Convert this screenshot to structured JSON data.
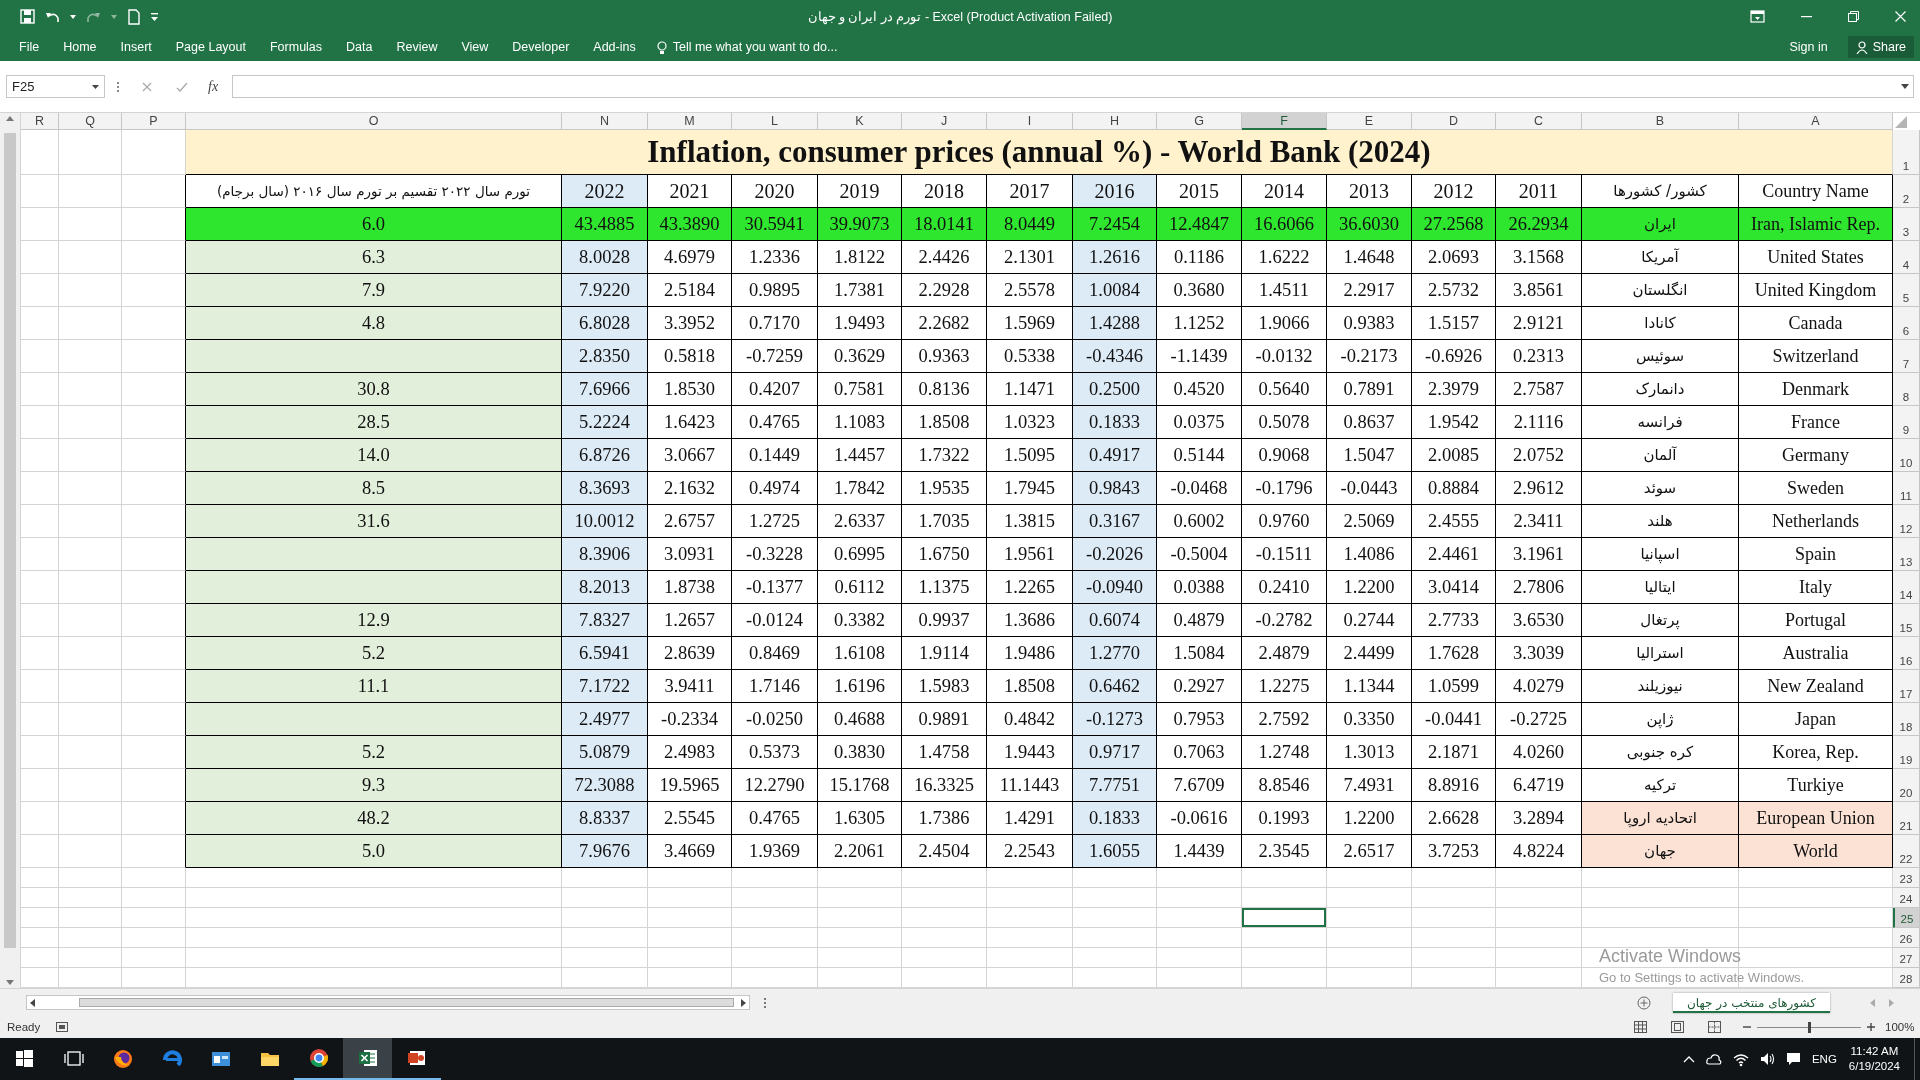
{
  "window": {
    "title": "تورم در ایران و جهان - Excel (Product Activation Failed)"
  },
  "ribbon": {
    "tabs": [
      {
        "label": "File",
        "selected": false
      },
      {
        "label": "Home",
        "selected": false
      },
      {
        "label": "Insert",
        "selected": false
      },
      {
        "label": "Page Layout",
        "selected": false
      },
      {
        "label": "Formulas",
        "selected": false
      },
      {
        "label": "Data",
        "selected": false
      },
      {
        "label": "Review",
        "selected": false
      },
      {
        "label": "View",
        "selected": false
      },
      {
        "label": "Developer",
        "selected": false
      },
      {
        "label": "Add-ins",
        "selected": false
      }
    ],
    "tell_me": "Tell me what you want to do...",
    "sign_in": "Sign in",
    "share": "Share"
  },
  "formula_bar": {
    "name_box": "F25",
    "function_label": "fx"
  },
  "sheet": {
    "columns": [
      {
        "label": "R",
        "selected": false
      },
      {
        "label": "Q",
        "selected": false
      },
      {
        "label": "P",
        "selected": false
      },
      {
        "label": "O",
        "selected": false
      },
      {
        "label": "N",
        "selected": false
      },
      {
        "label": "M",
        "selected": false
      },
      {
        "label": "L",
        "selected": false
      },
      {
        "label": "K",
        "selected": false
      },
      {
        "label": "J",
        "selected": false
      },
      {
        "label": "I",
        "selected": false
      },
      {
        "label": "H",
        "selected": false
      },
      {
        "label": "G",
        "selected": false
      },
      {
        "label": "F",
        "selected": true
      },
      {
        "label": "E",
        "selected": false
      },
      {
        "label": "D",
        "selected": false
      },
      {
        "label": "C",
        "selected": false
      },
      {
        "label": "B",
        "selected": false
      },
      {
        "label": "A",
        "selected": false
      }
    ],
    "rows": [
      {
        "label": "1",
        "selected": false
      },
      {
        "label": "2",
        "selected": false
      },
      {
        "label": "3",
        "selected": false
      },
      {
        "label": "4",
        "selected": false
      },
      {
        "label": "5",
        "selected": false
      },
      {
        "label": "6",
        "selected": false
      },
      {
        "label": "7",
        "selected": false
      },
      {
        "label": "8",
        "selected": false
      },
      {
        "label": "9",
        "selected": false
      },
      {
        "label": "10",
        "selected": false
      },
      {
        "label": "11",
        "selected": false
      },
      {
        "label": "12",
        "selected": false
      },
      {
        "label": "13",
        "selected": false
      },
      {
        "label": "14",
        "selected": false
      },
      {
        "label": "15",
        "selected": false
      },
      {
        "label": "16",
        "selected": false
      },
      {
        "label": "17",
        "selected": false
      },
      {
        "label": "18",
        "selected": false
      },
      {
        "label": "19",
        "selected": false
      },
      {
        "label": "20",
        "selected": false
      },
      {
        "label": "21",
        "selected": false
      },
      {
        "label": "22",
        "selected": false
      },
      {
        "label": "23",
        "selected": false
      },
      {
        "label": "24",
        "selected": false
      },
      {
        "label": "25",
        "selected": true
      },
      {
        "label": "26",
        "selected": false
      },
      {
        "label": "27",
        "selected": false
      },
      {
        "label": "28",
        "selected": false
      }
    ],
    "table": {
      "title": "Inflation, consumer prices (annual %) - World Bank (2024)",
      "header": {
        "ratio": "تورم سال ۲۰۲۲ تقسیم بر تورم سال ۲۰۱۶ (سال برجام)",
        "years": [
          {
            "label": "2022",
            "highlighted": true
          },
          {
            "label": "2021",
            "highlighted": false
          },
          {
            "label": "2020",
            "highlighted": false
          },
          {
            "label": "2019",
            "highlighted": false
          },
          {
            "label": "2018",
            "highlighted": false
          },
          {
            "label": "2017",
            "highlighted": false
          },
          {
            "label": "2016",
            "highlighted": true
          },
          {
            "label": "2015",
            "highlighted": false
          },
          {
            "label": "2014",
            "highlighted": false
          },
          {
            "label": "2013",
            "highlighted": false
          },
          {
            "label": "2012",
            "highlighted": false
          },
          {
            "label": "2011",
            "highlighted": false
          }
        ],
        "name_fa": "کشور/ کشورها",
        "name_en": "Country Name"
      },
      "records": [
        {
          "kind": "focus",
          "ratio": "6.0",
          "values": [
            "43.4885",
            "43.3890",
            "30.5941",
            "39.9073",
            "18.0141",
            "8.0449",
            "7.2454",
            "12.4847",
            "16.6066",
            "36.6030",
            "27.2568",
            "26.2934"
          ],
          "name_fa": "ایران",
          "name_en": "Iran, Islamic Rep."
        },
        {
          "kind": "plain",
          "ratio": "6.3",
          "values": [
            "8.0028",
            "4.6979",
            "1.2336",
            "1.8122",
            "2.4426",
            "2.1301",
            "1.2616",
            "0.1186",
            "1.6222",
            "1.4648",
            "2.0693",
            "3.1568"
          ],
          "name_fa": "آمریکا",
          "name_en": "United States"
        },
        {
          "kind": "plain",
          "ratio": "7.9",
          "values": [
            "7.9220",
            "2.5184",
            "0.9895",
            "1.7381",
            "2.2928",
            "2.5578",
            "1.0084",
            "0.3680",
            "1.4511",
            "2.2917",
            "2.5732",
            "3.8561"
          ],
          "name_fa": "انگلستان",
          "name_en": "United Kingdom"
        },
        {
          "kind": "plain",
          "ratio": "4.8",
          "values": [
            "6.8028",
            "3.3952",
            "0.7170",
            "1.9493",
            "2.2682",
            "1.5969",
            "1.4288",
            "1.1252",
            "1.9066",
            "0.9383",
            "1.5157",
            "2.9121"
          ],
          "name_fa": "کانادا",
          "name_en": "Canada"
        },
        {
          "kind": "plain",
          "values": [
            "2.8350",
            "0.5818",
            "-0.7259",
            "0.3629",
            "0.9363",
            "0.5338",
            "-0.4346",
            "-1.1439",
            "-0.0132",
            "-0.2173",
            "-0.6926",
            "0.2313"
          ],
          "name_fa": "سوئیس",
          "name_en": "Switzerland"
        },
        {
          "kind": "plain",
          "ratio": "30.8",
          "values": [
            "7.6966",
            "1.8530",
            "0.4207",
            "0.7581",
            "0.8136",
            "1.1471",
            "0.2500",
            "0.4520",
            "0.5640",
            "0.7891",
            "2.3979",
            "2.7587"
          ],
          "name_fa": "دانمارک",
          "name_en": "Denmark"
        },
        {
          "kind": "plain",
          "ratio": "28.5",
          "values": [
            "5.2224",
            "1.6423",
            "0.4765",
            "1.1083",
            "1.8508",
            "1.0323",
            "0.1833",
            "0.0375",
            "0.5078",
            "0.8637",
            "1.9542",
            "2.1116"
          ],
          "name_fa": "فرانسه",
          "name_en": "France"
        },
        {
          "kind": "plain",
          "ratio": "14.0",
          "values": [
            "6.8726",
            "3.0667",
            "0.1449",
            "1.4457",
            "1.7322",
            "1.5095",
            "0.4917",
            "0.5144",
            "0.9068",
            "1.5047",
            "2.0085",
            "2.0752"
          ],
          "name_fa": "آلمان",
          "name_en": "Germany"
        },
        {
          "kind": "plain",
          "ratio": "8.5",
          "values": [
            "8.3693",
            "2.1632",
            "0.4974",
            "1.7842",
            "1.9535",
            "1.7945",
            "0.9843",
            "-0.0468",
            "-0.1796",
            "-0.0443",
            "0.8884",
            "2.9612"
          ],
          "name_fa": "سوئد",
          "name_en": "Sweden"
        },
        {
          "kind": "plain",
          "ratio": "31.6",
          "values": [
            "10.0012",
            "2.6757",
            "1.2725",
            "2.6337",
            "1.7035",
            "1.3815",
            "0.3167",
            "0.6002",
            "0.9760",
            "2.5069",
            "2.4555",
            "2.3411"
          ],
          "name_fa": "هلند",
          "name_en": "Netherlands"
        },
        {
          "kind": "plain",
          "values": [
            "8.3906",
            "3.0931",
            "-0.3228",
            "0.6995",
            "1.6750",
            "1.9561",
            "-0.2026",
            "-0.5004",
            "-0.1511",
            "1.4086",
            "2.4461",
            "3.1961"
          ],
          "name_fa": "اسپانیا",
          "name_en": "Spain"
        },
        {
          "kind": "plain",
          "values": [
            "8.2013",
            "1.8738",
            "-0.1377",
            "0.6112",
            "1.1375",
            "1.2265",
            "-0.0940",
            "0.0388",
            "0.2410",
            "1.2200",
            "3.0414",
            "2.7806"
          ],
          "name_fa": "ایتالیا",
          "name_en": "Italy"
        },
        {
          "kind": "plain",
          "ratio": "12.9",
          "values": [
            "7.8327",
            "1.2657",
            "-0.0124",
            "0.3382",
            "0.9937",
            "1.3686",
            "0.6074",
            "0.4879",
            "-0.2782",
            "0.2744",
            "2.7733",
            "3.6530"
          ],
          "name_fa": "پرتغال",
          "name_en": "Portugal"
        },
        {
          "kind": "plain",
          "ratio": "5.2",
          "values": [
            "6.5941",
            "2.8639",
            "0.8469",
            "1.6108",
            "1.9114",
            "1.9486",
            "1.2770",
            "1.5084",
            "2.4879",
            "2.4499",
            "1.7628",
            "3.3039"
          ],
          "name_fa": "استرالیا",
          "name_en": "Australia"
        },
        {
          "kind": "plain",
          "ratio": "11.1",
          "values": [
            "7.1722",
            "3.9411",
            "1.7146",
            "1.6196",
            "1.5983",
            "1.8508",
            "0.6462",
            "0.2927",
            "1.2275",
            "1.1344",
            "1.0599",
            "4.0279"
          ],
          "name_fa": "نیوزیلند",
          "name_en": "New Zealand"
        },
        {
          "kind": "plain",
          "values": [
            "2.4977",
            "-0.2334",
            "-0.0250",
            "0.4688",
            "0.9891",
            "0.4842",
            "-0.1273",
            "0.7953",
            "2.7592",
            "0.3350",
            "-0.0441",
            "-0.2725"
          ],
          "name_fa": "ژاپن",
          "name_en": "Japan"
        },
        {
          "kind": "plain",
          "ratio": "5.2",
          "values": [
            "5.0879",
            "2.4983",
            "0.5373",
            "0.3830",
            "1.4758",
            "1.9443",
            "0.9717",
            "0.7063",
            "1.2748",
            "1.3013",
            "2.1871",
            "4.0260"
          ],
          "name_fa": "کره جنوبی",
          "name_en": "Korea, Rep."
        },
        {
          "kind": "plain",
          "ratio": "9.3",
          "values": [
            "72.3088",
            "19.5965",
            "12.2790",
            "15.1768",
            "16.3325",
            "11.1443",
            "7.7751",
            "7.6709",
            "8.8546",
            "7.4931",
            "8.8916",
            "6.4719"
          ],
          "name_fa": "ترکیه",
          "name_en": "Turkiye"
        },
        {
          "kind": "aggregate",
          "ratio": "48.2",
          "values": [
            "8.8337",
            "2.5545",
            "0.4765",
            "1.6305",
            "1.7386",
            "1.4291",
            "0.1833",
            "-0.0616",
            "0.1993",
            "1.2200",
            "2.6628",
            "3.2894"
          ],
          "name_fa": "اتحادیه اروپا",
          "name_en": "European Union"
        },
        {
          "kind": "aggregate",
          "ratio": "5.0",
          "values": [
            "7.9676",
            "3.4669",
            "1.9369",
            "2.2061",
            "2.4504",
            "2.2543",
            "1.6055",
            "1.4439",
            "2.3545",
            "2.6517",
            "3.7253",
            "4.8224"
          ],
          "name_fa": "جهان",
          "name_en": "World"
        }
      ]
    }
  },
  "os_notice": {
    "title": "Activate Windows",
    "message": "Go to Settings to activate Windows."
  },
  "sheet_tabs": [
    {
      "label": "کشورهای منتخب در جهان",
      "selected": true
    }
  ],
  "status_bar": {
    "mode": "Ready",
    "zoom": {
      "label": "100%",
      "level": 0.5
    }
  },
  "taskbar": {
    "apps": [
      {
        "kind": "start",
        "running": false,
        "selected": false
      },
      {
        "kind": "task_view",
        "running": false,
        "selected": false
      },
      {
        "kind": "fox_browser",
        "running": false,
        "selected": false
      },
      {
        "kind": "swirl_browser",
        "running": false,
        "selected": false
      },
      {
        "kind": "window_app",
        "running": false,
        "selected": false
      },
      {
        "kind": "folder",
        "running": false,
        "selected": false
      },
      {
        "kind": "ring_browser",
        "running": true,
        "selected": false
      },
      {
        "kind": "spreadsheet",
        "running": true,
        "selected": true
      },
      {
        "kind": "slides",
        "running": true,
        "selected": false
      }
    ],
    "language": "ENG",
    "time": "11:42 AM",
    "date": "6/19/2024"
  }
}
